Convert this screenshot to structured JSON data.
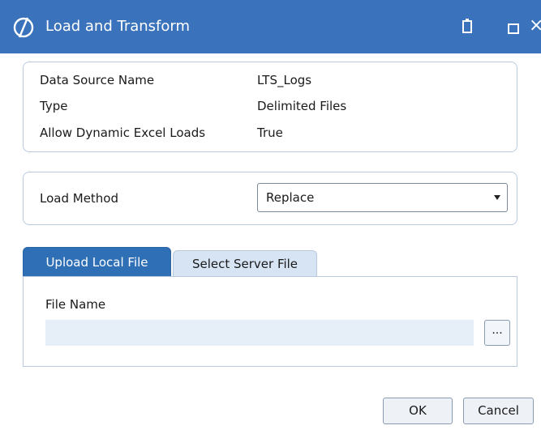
{
  "window": {
    "title": "Load and Transform",
    "icons": {
      "logo": "app-logo-icon",
      "clip": "clipboard-icon",
      "maximize": "maximize-icon",
      "close": "close-icon"
    },
    "close_glyph": "×"
  },
  "info": {
    "rows": [
      {
        "label": "Data Source Name",
        "value": "LTS_Logs"
      },
      {
        "label": "Type",
        "value": "Delimited Files"
      },
      {
        "label": "Allow Dynamic Excel Loads",
        "value": "True"
      }
    ]
  },
  "load_method": {
    "label": "Load Method",
    "selected": "Replace"
  },
  "tabs": [
    {
      "label": "Upload Local File",
      "active": true
    },
    {
      "label": "Select Server File",
      "active": false
    }
  ],
  "file": {
    "label": "File Name",
    "value": "",
    "browse_label": "..."
  },
  "buttons": {
    "ok": "OK",
    "cancel": "Cancel"
  },
  "colors": {
    "titlebar": "#3a73bb",
    "active_tab": "#2e6fb5",
    "inactive_tab": "#d7e4f4",
    "panel_border": "#b9c9dd"
  }
}
